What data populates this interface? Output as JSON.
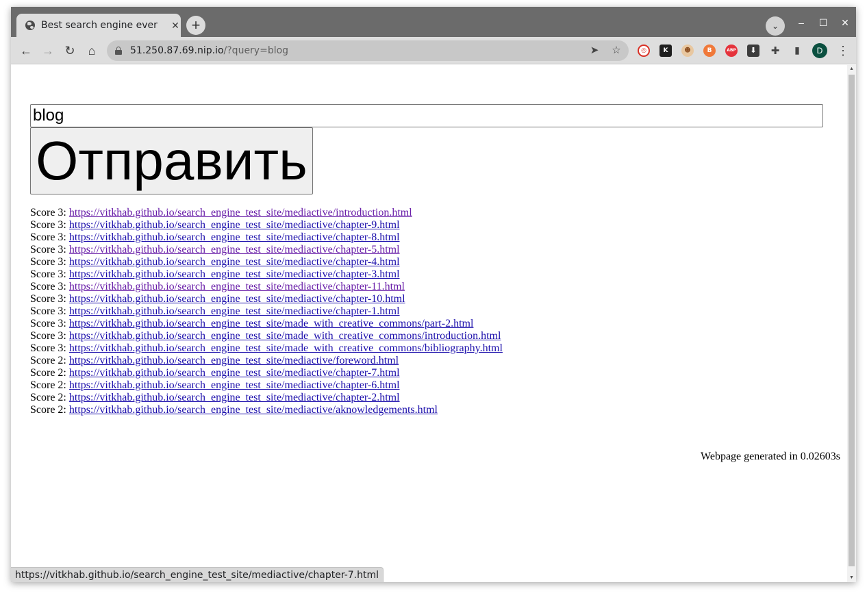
{
  "tab": {
    "title": "Best search engine ever",
    "close": "✕",
    "new_tab": "+"
  },
  "window_controls": {
    "tab_search": "⌄",
    "minimize": "–",
    "maximize": "☐",
    "close": "✕"
  },
  "toolbar": {
    "back": "←",
    "forward": "→",
    "reload": "↻",
    "home": "⌂",
    "url_host": "51.250.87.69.nip.io",
    "url_rest": "/?query=blog",
    "send_icon": "➤",
    "star_icon": "☆",
    "extensions": [
      {
        "name": "ext-red-circle-icon",
        "glyph": "◎",
        "color": "#d93025"
      },
      {
        "name": "ext-k-icon",
        "glyph": "K",
        "color": "#1f1f1f"
      },
      {
        "name": "ext-character-icon",
        "glyph": "☻",
        "color": "#b5651d"
      },
      {
        "name": "ext-orange-b-icon",
        "glyph": "B",
        "color": "#f0793a"
      },
      {
        "name": "ext-abp-icon",
        "glyph": "ABP",
        "color": "#e5333c"
      },
      {
        "name": "ext-download-icon",
        "glyph": "⬇",
        "color": "#3c3c3c"
      }
    ],
    "puzzle_icon": "✚",
    "sidepanel_icon": "▮",
    "profile_letter": "D",
    "menu": "⋮"
  },
  "search": {
    "query_value": "blog",
    "submit_label": "Отправить"
  },
  "results": [
    {
      "score": "Score 3:",
      "url": "https://vitkhab.github.io/search_engine_test_site/mediactive/introduction.html",
      "visited": true
    },
    {
      "score": "Score 3:",
      "url": "https://vitkhab.github.io/search_engine_test_site/mediactive/chapter-9.html",
      "visited": false
    },
    {
      "score": "Score 3:",
      "url": "https://vitkhab.github.io/search_engine_test_site/mediactive/chapter-8.html",
      "visited": false
    },
    {
      "score": "Score 3:",
      "url": "https://vitkhab.github.io/search_engine_test_site/mediactive/chapter-5.html",
      "visited": true
    },
    {
      "score": "Score 3:",
      "url": "https://vitkhab.github.io/search_engine_test_site/mediactive/chapter-4.html",
      "visited": false
    },
    {
      "score": "Score 3:",
      "url": "https://vitkhab.github.io/search_engine_test_site/mediactive/chapter-3.html",
      "visited": false
    },
    {
      "score": "Score 3:",
      "url": "https://vitkhab.github.io/search_engine_test_site/mediactive/chapter-11.html",
      "visited": true
    },
    {
      "score": "Score 3:",
      "url": "https://vitkhab.github.io/search_engine_test_site/mediactive/chapter-10.html",
      "visited": false
    },
    {
      "score": "Score 3:",
      "url": "https://vitkhab.github.io/search_engine_test_site/mediactive/chapter-1.html",
      "visited": false
    },
    {
      "score": "Score 3:",
      "url": "https://vitkhab.github.io/search_engine_test_site/made_with_creative_commons/part-2.html",
      "visited": false
    },
    {
      "score": "Score 3:",
      "url": "https://vitkhab.github.io/search_engine_test_site/made_with_creative_commons/introduction.html",
      "visited": false
    },
    {
      "score": "Score 3:",
      "url": "https://vitkhab.github.io/search_engine_test_site/made_with_creative_commons/bibliography.html",
      "visited": false
    },
    {
      "score": "Score 2:",
      "url": "https://vitkhab.github.io/search_engine_test_site/mediactive/foreword.html",
      "visited": false
    },
    {
      "score": "Score 2:",
      "url": "https://vitkhab.github.io/search_engine_test_site/mediactive/chapter-7.html",
      "visited": false
    },
    {
      "score": "Score 2:",
      "url": "https://vitkhab.github.io/search_engine_test_site/mediactive/chapter-6.html",
      "visited": false
    },
    {
      "score": "Score 2:",
      "url": "https://vitkhab.github.io/search_engine_test_site/mediactive/chapter-2.html",
      "visited": false
    },
    {
      "score": "Score 2:",
      "url": "https://vitkhab.github.io/search_engine_test_site/mediactive/aknowledgements.html",
      "visited": false
    }
  ],
  "footer": {
    "generated": "Webpage generated in 0.02603s"
  },
  "status_bar": {
    "hover_url": "https://vitkhab.github.io/search_engine_test_site/mediactive/chapter-7.html"
  },
  "colors": {
    "link": "#1a0dab",
    "visited_link": "#681da8",
    "titlebar": "#6b6b6b",
    "toolbar": "#dedede"
  }
}
